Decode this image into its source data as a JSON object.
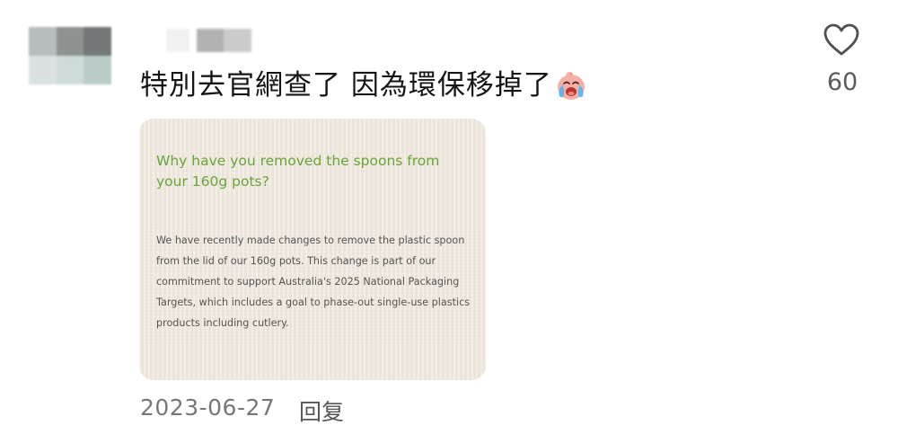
{
  "comment": {
    "text": "特別去官網查了 因為環保移掉了",
    "emoji": "crying-face-emoji",
    "like_icon": "heart-outline-icon",
    "like_count": "60",
    "timestamp": "2023-06-27",
    "reply_label": "回复"
  },
  "attached_image": {
    "question": "Why have you removed the spoons from your 160g pots?",
    "answer": "We have recently made changes to remove the plastic spoon from the lid of our 160g pots. This change is part of our commitment to support Australia's 2025 National Packaging Targets, which includes a goal to phase-out single-use plastics products including cutlery."
  },
  "colors": {
    "question_green": "#6aa43a",
    "card_background": "#f1ebe0",
    "comment_text": "#151515",
    "meta_text": "#777777"
  }
}
